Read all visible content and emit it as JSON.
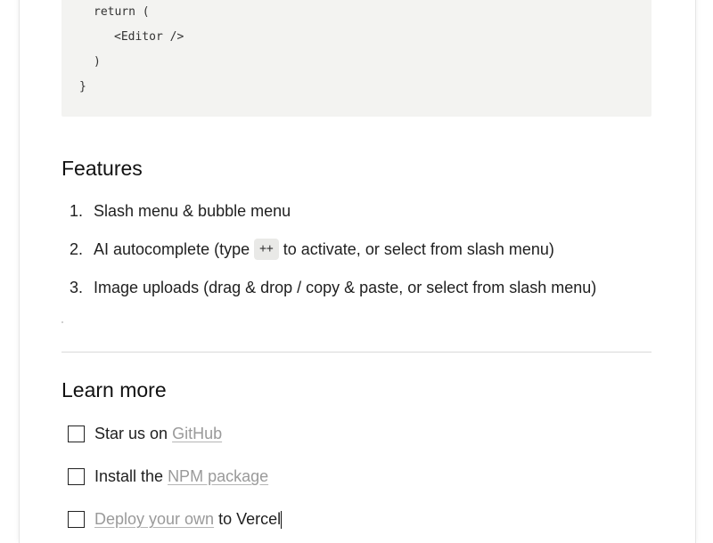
{
  "code": {
    "lines": [
      {
        "text": "return ("
      },
      {
        "text": "<Editor />"
      },
      {
        "text": ")"
      },
      {
        "text": "}"
      }
    ]
  },
  "features": {
    "heading": "Features",
    "items": [
      {
        "num": "1.",
        "text": "Slash menu & bubble menu"
      },
      {
        "num": "2.",
        "text_before": "AI autocomplete (type",
        "code": "++",
        "text_after": "to activate, or select from slash menu)"
      },
      {
        "num": "3.",
        "text": "Image uploads (drag & drop / copy & paste, or select from slash menu)"
      }
    ]
  },
  "learn_more": {
    "heading": "Learn more",
    "tasks": [
      {
        "before": "Star us on",
        "link": "GitHub",
        "after": "",
        "checked": false
      },
      {
        "before": "Install the",
        "link": "NPM package",
        "after": "",
        "checked": false
      },
      {
        "before": "",
        "link": "Deploy your own",
        "after": "to Vercel",
        "checked": false
      }
    ]
  },
  "colors": {
    "code_bg": "#f3f3f1",
    "link": "#9a9a9a",
    "divider": "#d9d9d9"
  }
}
